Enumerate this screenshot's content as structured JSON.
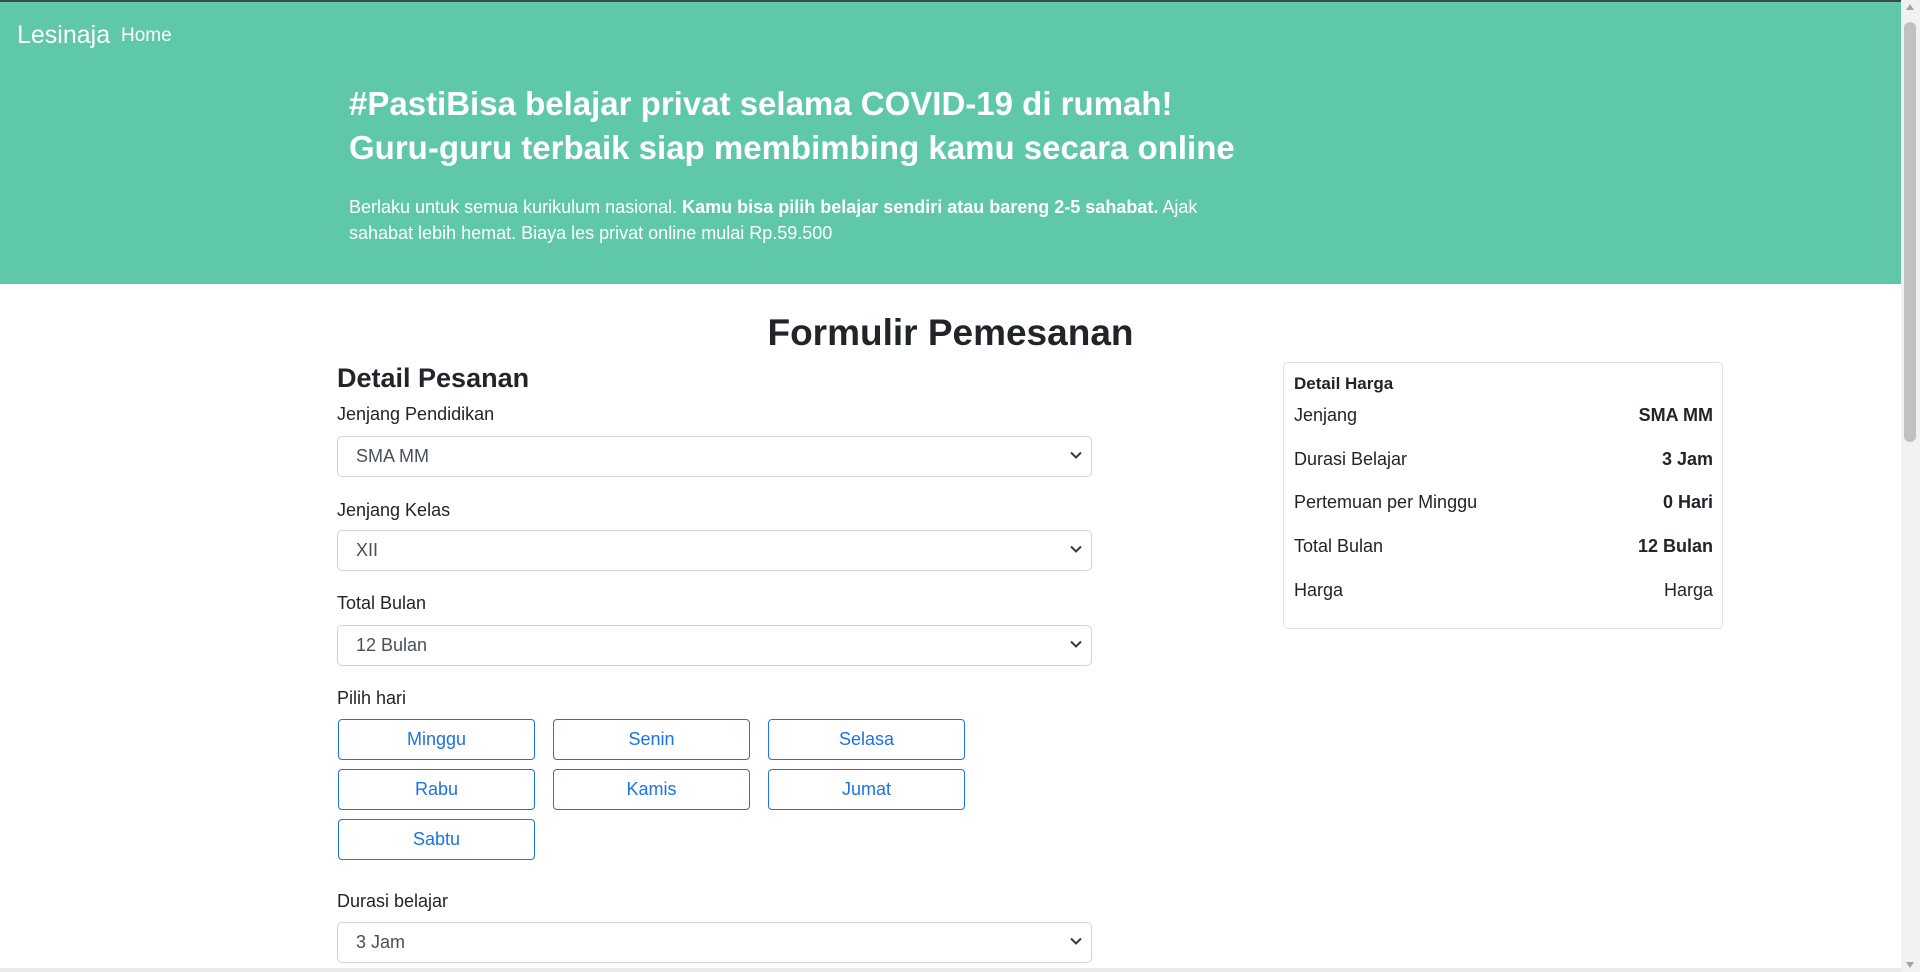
{
  "navbar": {
    "brand": "Lesinaja",
    "home": "Home"
  },
  "hero": {
    "line1": "#PastiBisa belajar privat selama COVID-19 di rumah!",
    "line2": "Guru-guru terbaik siap membimbing kamu secara online",
    "desc_start": "Berlaku untuk semua kurikulum nasional. ",
    "desc_bold": "Kamu bisa pilih belajar sendiri atau bareng 2-5 sahabat.",
    "desc_end": " Ajak sahabat lebih hemat. Biaya les privat online mulai Rp.59.500"
  },
  "form": {
    "title": "Formulir Pemesanan",
    "section_title": "Detail Pesanan",
    "jenjang_label": "Jenjang Pendidikan",
    "jenjang_value": "SMA MM",
    "kelas_label": "Jenjang Kelas",
    "kelas_value": "XII",
    "bulan_label": "Total Bulan",
    "bulan_value": "12 Bulan",
    "hari_label": "Pilih hari",
    "days": [
      "Minggu",
      "Senin",
      "Selasa",
      "Rabu",
      "Kamis",
      "Jumat",
      "Sabtu"
    ],
    "durasi_label": "Durasi belajar",
    "durasi_value": "3 Jam"
  },
  "price_card": {
    "title": "Detail Harga",
    "rows": [
      {
        "key": "Jenjang",
        "value": "SMA MM"
      },
      {
        "key": "Durasi Belajar",
        "value": "3 Jam"
      },
      {
        "key": "Pertemuan per Minggu",
        "value": "0 Hari"
      },
      {
        "key": "Total Bulan",
        "value": "12 Bulan"
      },
      {
        "key": "Harga",
        "value": "Harga"
      }
    ]
  },
  "colors": {
    "hero_bg": "#5fc8a8",
    "accent": "#1a73e8"
  },
  "icons": {
    "select_arrow": "chevron-down-icon"
  }
}
